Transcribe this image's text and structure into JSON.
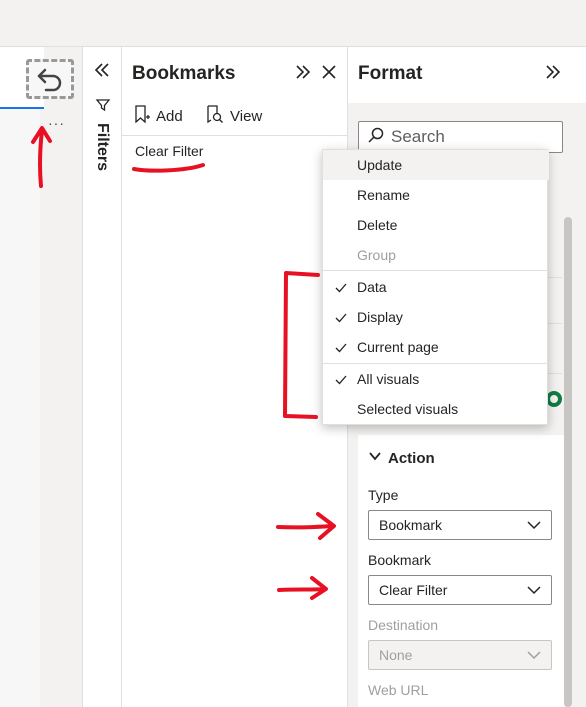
{
  "filters_pane": {
    "label": "Filters",
    "collapse_icon": "chevron-double-left-icon",
    "funnel_icon": "funnel-icon"
  },
  "canvas": {
    "more_options": "···",
    "undo_icon": "undo-icon"
  },
  "bookmarks": {
    "title": "Bookmarks",
    "add_label": "Add",
    "view_label": "View",
    "items": [
      "Clear Filter"
    ]
  },
  "format": {
    "title": "Format",
    "search_placeholder": "Search"
  },
  "context_menu": {
    "update": "Update",
    "rename": "Rename",
    "delete": "Delete",
    "group": "Group",
    "data": "Data",
    "display": "Display",
    "current_page": "Current page",
    "all_visuals": "All visuals",
    "selected_visuals": "Selected visuals"
  },
  "action": {
    "header": "Action",
    "type_label": "Type",
    "type_value": "Bookmark",
    "bookmark_label": "Bookmark",
    "bookmark_value": "Clear Filter",
    "destination_label": "Destination",
    "destination_value": "None",
    "weburl_label": "Web URL"
  },
  "colors": {
    "annotation_red": "#e81123",
    "accent_blue": "#1a73e8",
    "toggle_green": "#107c41"
  }
}
